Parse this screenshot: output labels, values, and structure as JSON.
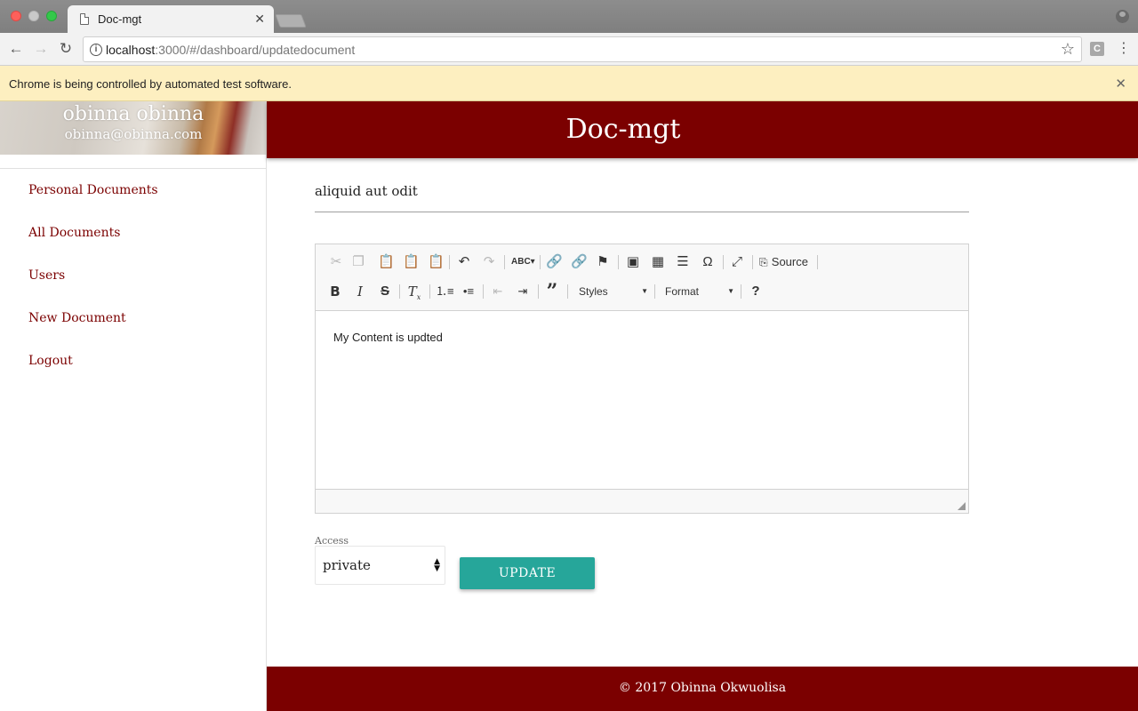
{
  "browser": {
    "tab_title": "Doc-mgt",
    "url_host": "localhost",
    "url_rest": ":3000/#/dashboard/updatedocument",
    "infobar_text": "Chrome is being controlled by automated test software.",
    "extension_label": "C"
  },
  "user": {
    "name": "obinna obinna",
    "email": "obinna@obinna.com"
  },
  "sidebar": {
    "items": [
      {
        "label": "Personal Documents"
      },
      {
        "label": "All Documents"
      },
      {
        "label": "Users"
      },
      {
        "label": "New Document"
      },
      {
        "label": "Logout"
      }
    ]
  },
  "header": {
    "title": "Doc-mgt"
  },
  "document": {
    "title": "aliquid aut odit",
    "content": "My Content is updted"
  },
  "editor": {
    "source_label": "Source",
    "styles_label": "Styles",
    "format_label": "Format"
  },
  "form": {
    "access_label": "Access",
    "access_value": "private",
    "update_label": "UPDATE"
  },
  "footer": {
    "text": "© 2017 Obinna Okwuolisa"
  },
  "colors": {
    "brand": "#7b0000",
    "button": "#26a69a",
    "infobar": "#fdefc0"
  }
}
